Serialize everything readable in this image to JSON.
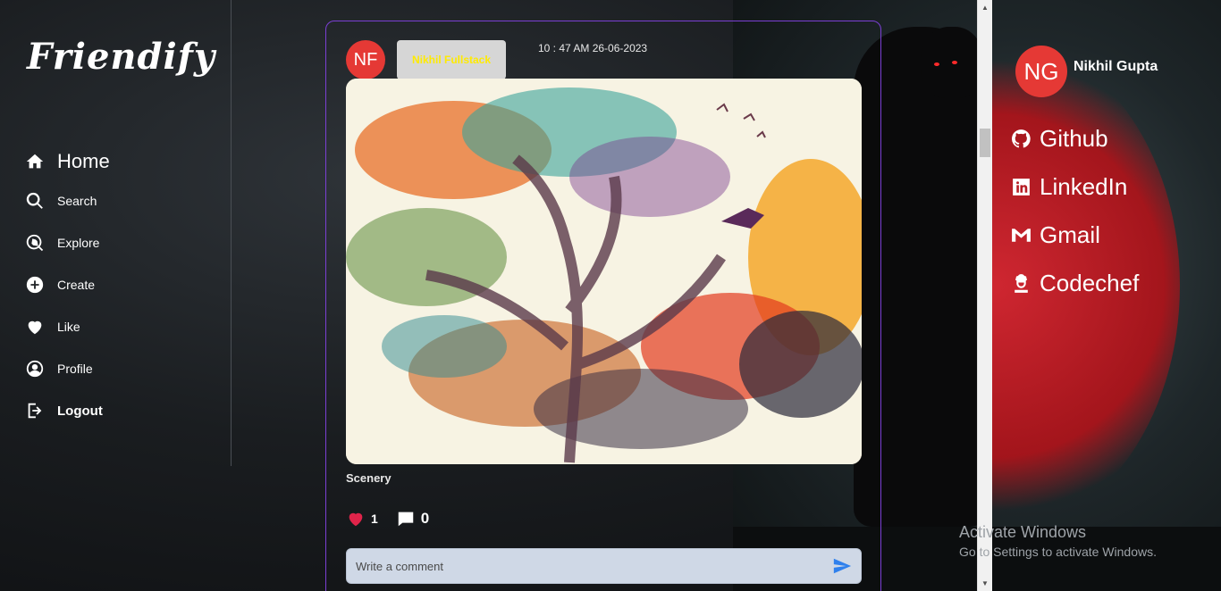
{
  "app": {
    "logo": "Friendify"
  },
  "sidebar": {
    "items": [
      {
        "label": "Home",
        "icon": "home-icon"
      },
      {
        "label": "Search",
        "icon": "search-icon"
      },
      {
        "label": "Explore",
        "icon": "explore-icon"
      },
      {
        "label": "Create",
        "icon": "plus-circle-icon"
      },
      {
        "label": "Like",
        "icon": "heart-icon"
      },
      {
        "label": "Profile",
        "icon": "user-circle-icon"
      },
      {
        "label": "Logout",
        "icon": "logout-icon"
      }
    ]
  },
  "post": {
    "avatar_initials": "NF",
    "author": "Nikhil Fullstack",
    "timestamp": "10 : 47 AM 26-06-2023",
    "image_subject": "watercolor tree with bird",
    "caption": "Scenery",
    "likes": "1",
    "comments": "0",
    "comment_placeholder": "Write a comment"
  },
  "profile": {
    "initials": "NG",
    "name": "Nikhil Gupta",
    "links": [
      {
        "label": "Github",
        "icon": "github-icon"
      },
      {
        "label": "LinkedIn",
        "icon": "linkedin-icon"
      },
      {
        "label": "Gmail",
        "icon": "gmail-icon"
      },
      {
        "label": "Codechef",
        "icon": "codechef-icon"
      }
    ]
  },
  "watermark": {
    "title": "Activate Windows",
    "subtitle": "Go to Settings to activate Windows."
  },
  "colors": {
    "accent_border": "#7b3fd4",
    "avatar_red": "#e53935",
    "author_name_yellow": "#ffeb00",
    "like_heart": "#e0244a",
    "send_icon": "#2f80ed"
  }
}
